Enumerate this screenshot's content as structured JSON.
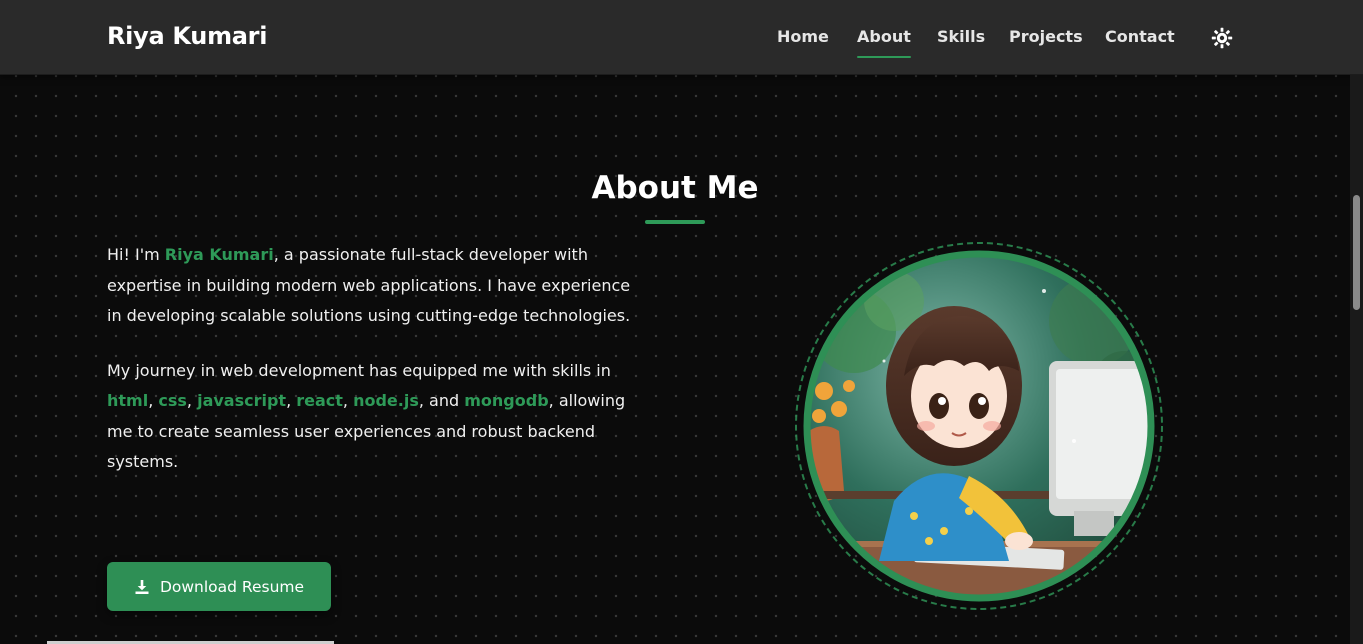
{
  "brand": "Riya Kumari",
  "nav": {
    "items": [
      {
        "label": "Home",
        "active": false
      },
      {
        "label": "About",
        "active": true
      },
      {
        "label": "Skills",
        "active": false
      },
      {
        "label": "Projects",
        "active": false
      },
      {
        "label": "Contact",
        "active": false
      }
    ],
    "theme_toggle_icon": "sun-icon"
  },
  "about": {
    "title": "About Me",
    "p1": {
      "before": "Hi! I'm ",
      "name": "Riya Kumari",
      "after": ", a passionate full-stack developer with expertise in building modern web applications. I have experience in developing scalable solutions using cutting-edge technologies."
    },
    "p2": {
      "before": "My journey in web development has equipped me with skills in ",
      "skills": [
        "html",
        "css",
        "javascript",
        "react",
        "node.js",
        "mongodb"
      ],
      "sep": ", ",
      "and": ", and ",
      "after": ", allowing me to create seamless user experiences and robust backend systems."
    },
    "download_label": "Download Resume",
    "download_icon": "download-icon",
    "avatar_icon": "anime-girl-at-computer-avatar"
  },
  "colors": {
    "accent": "#2e9a58",
    "background": "#0b0b0b",
    "navbar": "#2a2a2a"
  }
}
